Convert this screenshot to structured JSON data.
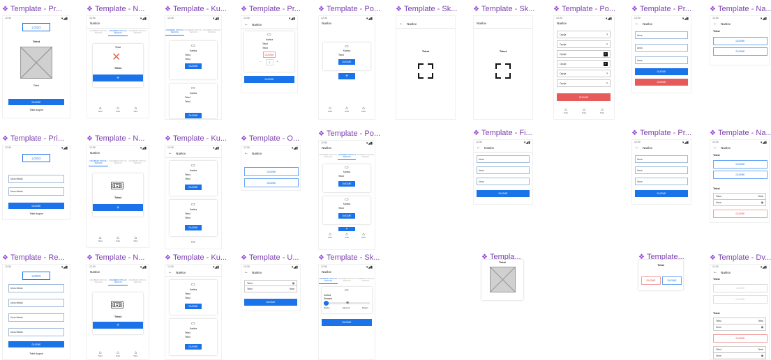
{
  "templates": [
    "Template - Pr...",
    "Template - N...",
    "Template - Ku...",
    "Template - Pr...",
    "Template - Po...",
    "Template - Sk...",
    "Template - Sk...",
    "Template - Po...",
    "Template - Pr...",
    "Template - Na...",
    "Template - Pri...",
    "Template - N...",
    "Template - Ku...",
    "Template - O...",
    "Template - Po...",
    "Template - Fi...",
    "Template - Pr...",
    "Template - Na...",
    "Template - Re...",
    "Template - N...",
    "Template - Ku...",
    "Template - U...",
    "Template - Sk...",
    "Templa...",
    "Template...",
    "Template - Dv..."
  ],
  "ui": {
    "time": "12:30",
    "signal": "▾◢▮",
    "logo": "LOGO",
    "tekst": "Tekst",
    "tekst_sm": "Tekst",
    "naslov": "Naslov",
    "back": "←",
    "dugme": "DUGME",
    "opcija": "Opcija",
    "tekst_dugme": "Tekst dugme",
    "unos": "Unos",
    "unos_teksta": "Unos teksta",
    "tab1": "ODABERI OPCIJU TEKSTA",
    "tab2": "ODABERI OPCIJU TEKSTA",
    "tab3": "ODABERI OPCIJU TEKSTA",
    "kartica": "Kartica",
    "nav1": "Tekst",
    "nav2": "Tekst",
    "nav3": "Tekst",
    "plus": "+",
    "minus": "−",
    "qty": "1",
    "chevron": "›",
    "check": "✓",
    "calendar": "▦",
    "step_a": "Naslov",
    "step_b": "Element",
    "step_c": "Naslov"
  },
  "colors": {
    "title": "#7b3fb0",
    "primary": "#1a73e8",
    "danger": "#e55b5b",
    "placeholder": "#d0d0d0"
  },
  "icons": {
    "title_icon": "purple-diamond-icon",
    "card_icon": "card-icon",
    "nav_icon": "home-icon",
    "ticket_icon": "ticket-icon"
  }
}
